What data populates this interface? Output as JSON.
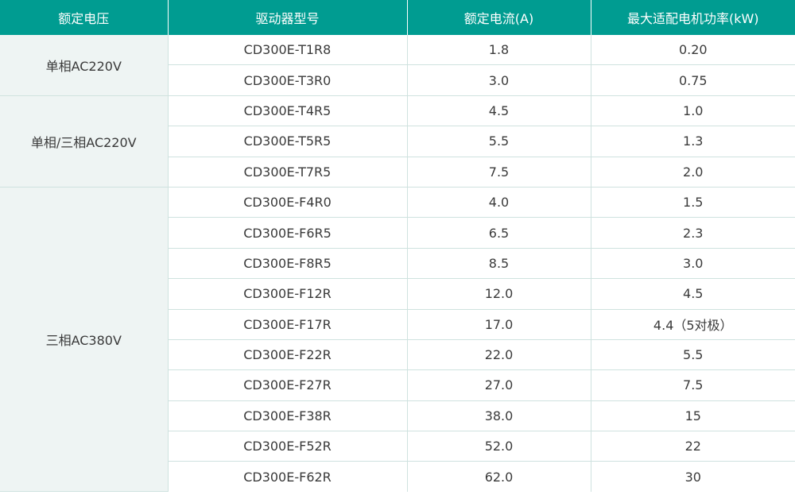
{
  "table": {
    "headers": [
      "额定电压",
      "驱动器型号",
      "额定电流(A)",
      "最大适配电机功率(kW)"
    ],
    "groups": [
      {
        "voltage": "单相AC220V",
        "rows": [
          {
            "model": "CD300E-T1R8",
            "current": "1.8",
            "power": "0.20"
          },
          {
            "model": "CD300E-T3R0",
            "current": "3.0",
            "power": "0.75"
          }
        ]
      },
      {
        "voltage": "单相/三相AC220V",
        "rows": [
          {
            "model": "CD300E-T4R5",
            "current": "4.5",
            "power": "1.0"
          },
          {
            "model": "CD300E-T5R5",
            "current": "5.5",
            "power": "1.3"
          },
          {
            "model": "CD300E-T7R5",
            "current": "7.5",
            "power": "2.0"
          }
        ]
      },
      {
        "voltage": "三相AC380V",
        "rows": [
          {
            "model": "CD300E-F4R0",
            "current": "4.0",
            "power": "1.5"
          },
          {
            "model": "CD300E-F6R5",
            "current": "6.5",
            "power": "2.3"
          },
          {
            "model": "CD300E-F8R5",
            "current": "8.5",
            "power": "3.0"
          },
          {
            "model": "CD300E-F12R",
            "current": "12.0",
            "power": "4.5"
          },
          {
            "model": "CD300E-F17R",
            "current": "17.0",
            "power": "4.4（5对极）"
          },
          {
            "model": "CD300E-F22R",
            "current": "22.0",
            "power": "5.5"
          },
          {
            "model": "CD300E-F27R",
            "current": "27.0",
            "power": "7.5"
          },
          {
            "model": "CD300E-F38R",
            "current": "38.0",
            "power": "15"
          },
          {
            "model": "CD300E-F52R",
            "current": "52.0",
            "power": "22"
          },
          {
            "model": "CD300E-F62R",
            "current": "62.0",
            "power": "30"
          }
        ]
      }
    ]
  },
  "colors": {
    "header_bg": "#009c91",
    "header_text": "#ffffff",
    "voltage_cell_bg": "#eef4f3",
    "grid_line": "#cfe2df",
    "body_text": "#3a3a3a"
  }
}
